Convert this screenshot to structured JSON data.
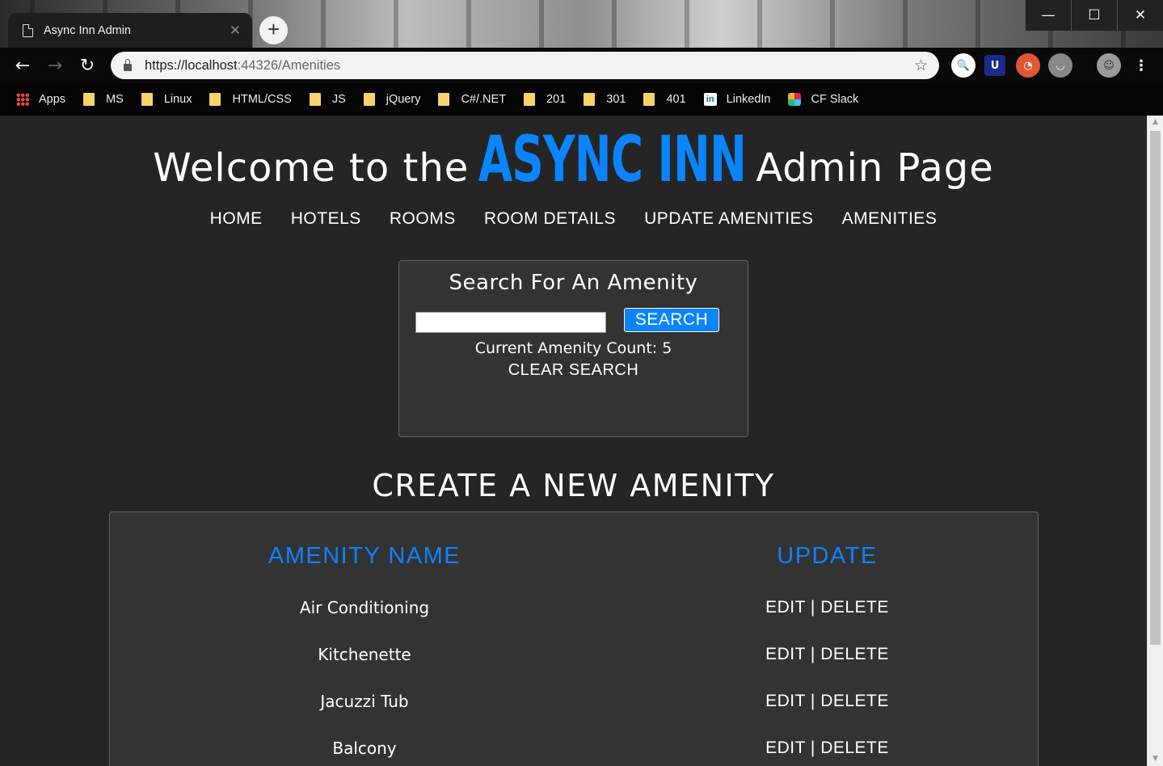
{
  "browser": {
    "tab_title": "Async Inn Admin",
    "tab_close": "✕",
    "new_tab": "+",
    "url_host": "https://localhost",
    "url_path": ":44326/Amenities",
    "window_controls": [
      "—",
      "☐",
      "✕"
    ],
    "bookmarks": [
      {
        "label": "Apps",
        "icon": "apps-grid-icon"
      },
      {
        "label": "MS",
        "icon": "folder-icon"
      },
      {
        "label": "Linux",
        "icon": "folder-icon"
      },
      {
        "label": "HTML/CSS",
        "icon": "folder-icon"
      },
      {
        "label": "JS",
        "icon": "folder-icon"
      },
      {
        "label": "jQuery",
        "icon": "folder-icon"
      },
      {
        "label": "C#/.NET",
        "icon": "folder-icon"
      },
      {
        "label": "201",
        "icon": "folder-icon"
      },
      {
        "label": "301",
        "icon": "folder-icon"
      },
      {
        "label": "401",
        "icon": "folder-icon"
      },
      {
        "label": "LinkedIn",
        "icon": "linkedin-icon"
      },
      {
        "label": "CF Slack",
        "icon": "slack-icon"
      }
    ]
  },
  "hero": {
    "welcome": "Welcome to the",
    "brand": "ASYNC INN",
    "suffix": "Admin Page"
  },
  "nav": [
    "HOME",
    "HOTELS",
    "ROOMS",
    "ROOM DETAILS",
    "UPDATE AMENITIES",
    "AMENITIES"
  ],
  "search": {
    "title": "Search For An Amenity",
    "input_value": "",
    "button": "SEARCH",
    "count_text": "Current Amenity Count: 5",
    "clear": "CLEAR SEARCH"
  },
  "create_link": "CREATE A NEW AMENITY",
  "table": {
    "headers": [
      "AMENITY NAME",
      "UPDATE"
    ],
    "rows": [
      {
        "name": "Air Conditioning",
        "edit": "EDIT",
        "sep": " | ",
        "delete": "DELETE"
      },
      {
        "name": "Kitchenette",
        "edit": "EDIT",
        "sep": " | ",
        "delete": "DELETE"
      },
      {
        "name": "Jacuzzi Tub",
        "edit": "EDIT",
        "sep": " | ",
        "delete": "DELETE"
      },
      {
        "name": "Balcony",
        "edit": "EDIT",
        "sep": " | ",
        "delete": "DELETE"
      }
    ]
  },
  "colors": {
    "accent": "#0a84ff",
    "page_bg": "#252525",
    "panel_bg": "#333333"
  }
}
